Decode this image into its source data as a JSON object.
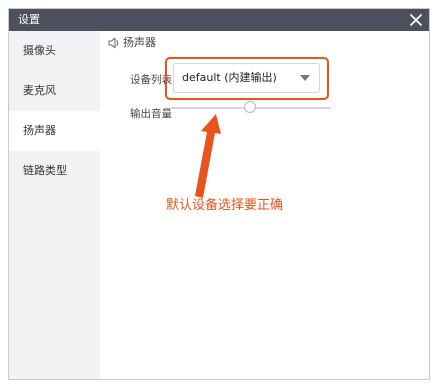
{
  "window": {
    "title": "设置",
    "close_icon": "close-icon"
  },
  "sidebar": {
    "items": [
      {
        "label": "摄像头"
      },
      {
        "label": "麦克风"
      },
      {
        "label": "扬声器",
        "active": true
      },
      {
        "label": "链路类型"
      }
    ]
  },
  "speaker": {
    "section_title": "扬声器",
    "section_icon": "speaker-icon",
    "device_label": "设备列表",
    "device_value": "default (内建输出)",
    "volume_label": "输出音量"
  },
  "annotation": {
    "text": "默认设备选择要正确",
    "color": "#e8541e"
  },
  "colors": {
    "titlebar": "#4d505d",
    "sidebar_bg": "#f2f2f4",
    "accent": "#e8541e"
  }
}
